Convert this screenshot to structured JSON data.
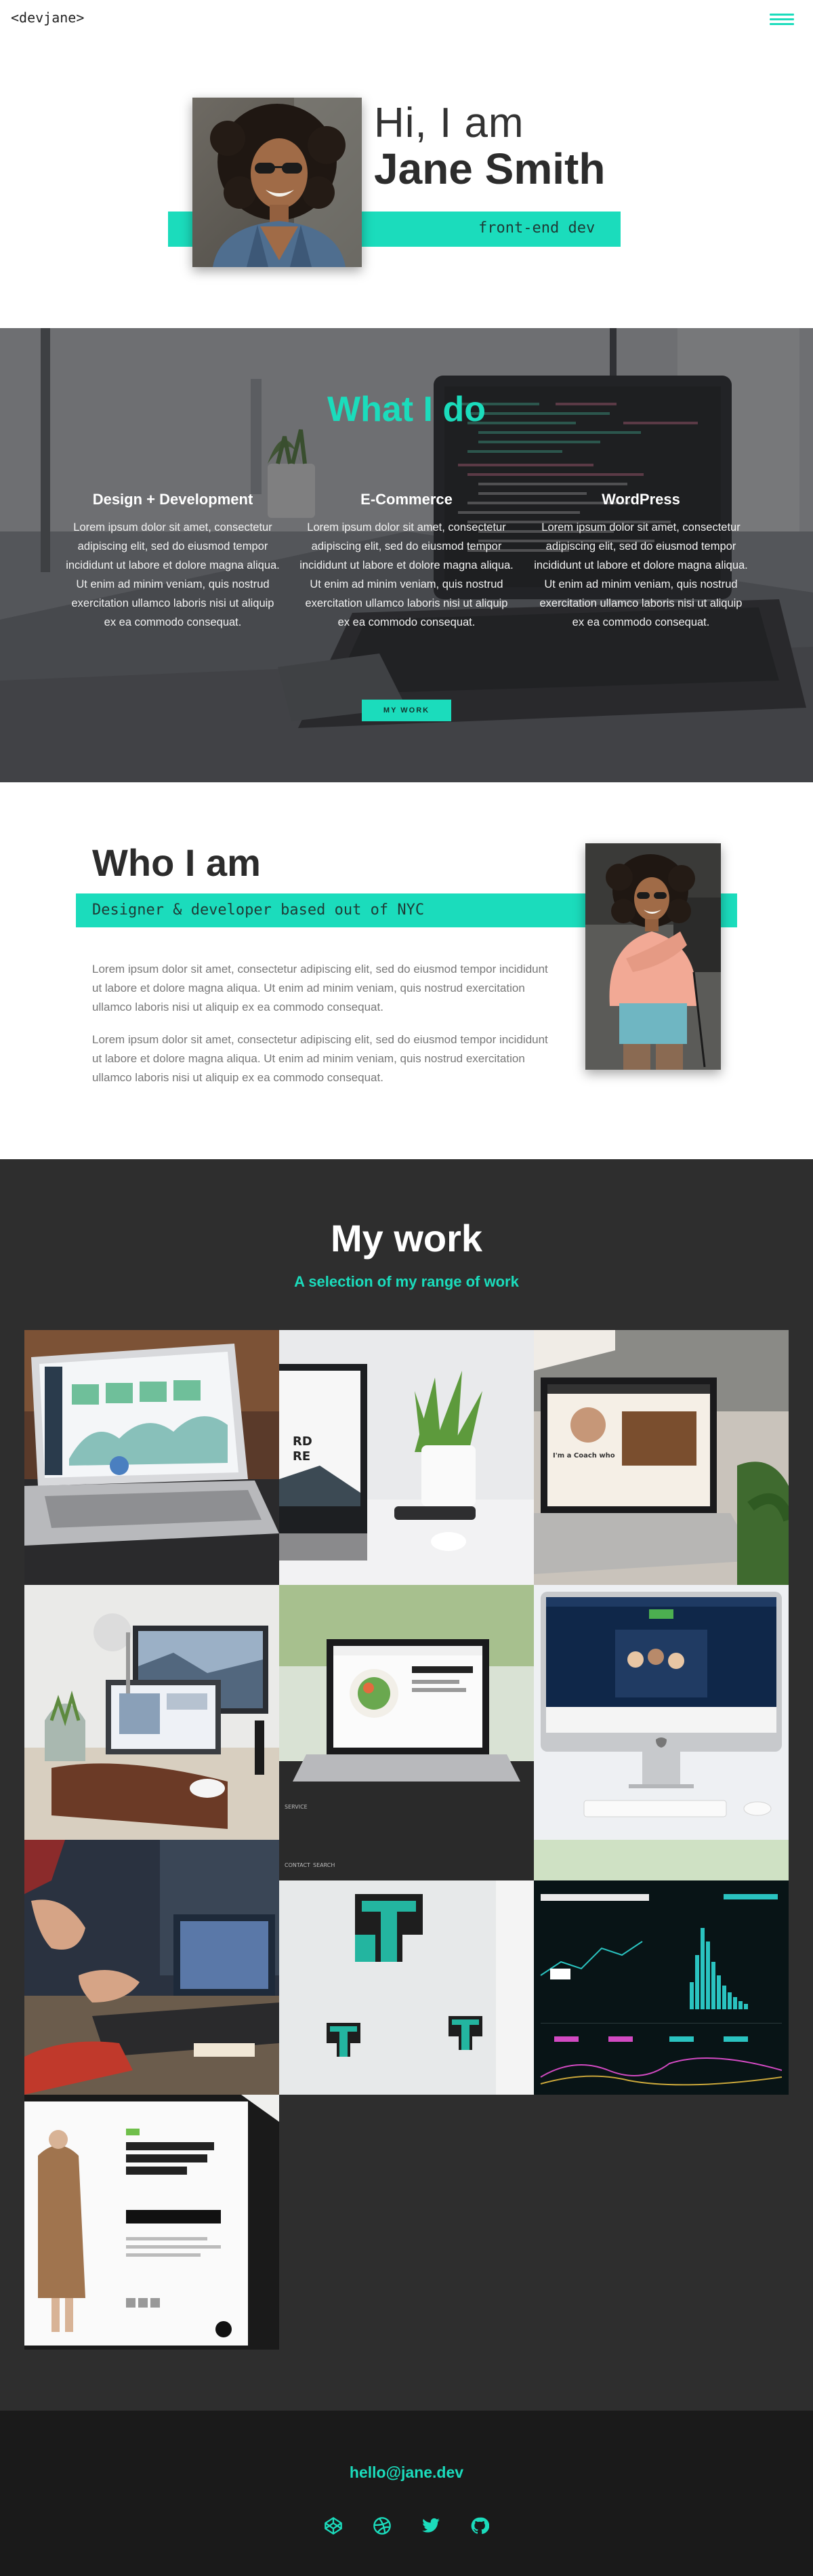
{
  "header": {
    "logo": "<devjane>",
    "menu_icon": "hamburger-menu-icon"
  },
  "hero": {
    "greeting": "Hi, I am",
    "name": "Jane Smith",
    "role": "front-end dev"
  },
  "services": {
    "title": "What I do",
    "items": [
      {
        "title": "Design + Development",
        "text": "Lorem ipsum dolor sit amet, consectetur adipiscing elit, sed do eiusmod tempor incididunt ut labore et dolore magna aliqua. Ut enim ad minim veniam, quis nostrud exercitation ullamco laboris nisi ut aliquip ex ea commodo consequat."
      },
      {
        "title": "E-Commerce",
        "text": "Lorem ipsum dolor sit amet, consectetur adipiscing elit, sed do eiusmod tempor incididunt ut labore et dolore magna aliqua. Ut enim ad minim veniam, quis nostrud exercitation ullamco laboris nisi ut aliquip ex ea commodo consequat."
      },
      {
        "title": "WordPress",
        "text": "Lorem ipsum dolor sit amet, consectetur adipiscing elit, sed do eiusmod tempor incididunt ut labore et dolore magna aliqua. Ut enim ad minim veniam, quis nostrud exercitation ullamco laboris nisi ut aliquip ex ea commodo consequat."
      }
    ],
    "button_label": "MY WORK"
  },
  "about": {
    "title": "Who I am",
    "tagline": "Designer & developer based out of NYC",
    "paragraphs": [
      "Lorem ipsum dolor sit amet, consectetur adipiscing elit, sed do eiusmod tempor incididunt ut labore et dolore magna aliqua. Ut enim ad minim veniam, quis nostrud exercitation ullamco laboris nisi ut aliquip ex ea commodo consequat.",
      "Lorem ipsum dolor sit amet, consectetur adipiscing elit, sed do eiusmod tempor incididunt ut labore et dolore magna aliqua. Ut enim ad minim veniam, quis nostrud exercitation ullamco laboris nisi ut aliquip ex ea commodo consequat."
    ]
  },
  "work": {
    "title": "My work",
    "subtitle": "A selection of my range of work",
    "tile_count": 10
  },
  "footer": {
    "email": "hello@jane.dev",
    "social_icons": [
      "codepen-icon",
      "dribbble-icon",
      "twitter-icon",
      "github-icon"
    ]
  },
  "colors": {
    "accent": "#1bdcbc",
    "dark_section": "#2e2e2e",
    "footer": "#1a1a1a",
    "text": "#2f2f2f"
  }
}
